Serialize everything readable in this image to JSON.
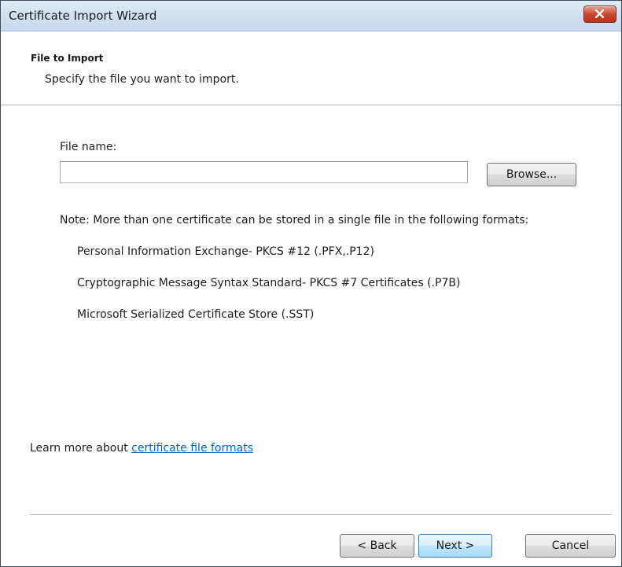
{
  "window": {
    "title": "Certificate Import Wizard"
  },
  "header": {
    "heading": "File to Import",
    "subheading": "Specify the file you want to import."
  },
  "form": {
    "file_label": "File name:",
    "file_value": "",
    "file_placeholder": "",
    "browse_label": "Browse..."
  },
  "note": {
    "text": "Note:  More than one certificate can be stored in a single file in the following formats:",
    "formats": [
      "Personal Information Exchange- PKCS #12 (.PFX,.P12)",
      "Cryptographic Message Syntax Standard- PKCS #7 Certificates (.P7B)",
      "Microsoft Serialized Certificate Store (.SST)"
    ]
  },
  "learn_more": {
    "prefix": "Learn more about ",
    "link_text": "certificate file formats"
  },
  "footer": {
    "back_label": "< Back",
    "next_label": "Next >",
    "cancel_label": "Cancel"
  },
  "icons": {
    "close": "close-icon"
  },
  "colors": {
    "link": "#0066cc",
    "close_button": "#c9472f",
    "title_bar": "#c6d7ec",
    "default_button_border": "#3c7fb1"
  }
}
